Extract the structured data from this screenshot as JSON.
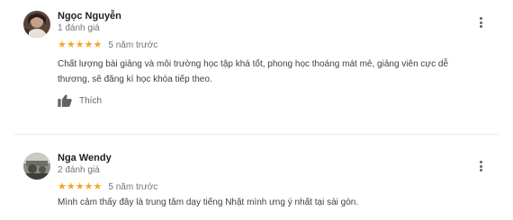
{
  "reviews": [
    {
      "author": "Ngọc Nguyễn",
      "review_count": "1 đánh giá",
      "stars": [
        "★",
        "★",
        "★",
        "★",
        "★"
      ],
      "rating": 5,
      "age": "5 năm trước",
      "text": "Chất lượng bài giảng và môi trường học tập khá tốt, phong học thoáng mát mẻ, giảng viên cực dễ thương, sẽ đăng kí học khóa tiếp theo.",
      "like_label": "Thích",
      "avatar_icon": "profile-photo-icon",
      "more_icon": "more-vert-icon"
    },
    {
      "author": "Nga Wendy",
      "review_count": "2 đánh giá",
      "stars": [
        "★",
        "★",
        "★",
        "★",
        "★"
      ],
      "rating": 5,
      "age": "5 năm trước",
      "text": "Mình cảm thấy đây là trung tâm dạy tiếng Nhật mình ưng ý nhất tại sài gòn.",
      "avatar_icon": "profile-photo-icon",
      "more_icon": "more-vert-icon"
    }
  ],
  "colors": {
    "star": "#f1a72b",
    "author": "#202124",
    "secondary_text": "#70757a",
    "body_text": "#3c4043",
    "icon": "#5f6368",
    "divider": "#e8eaed"
  }
}
